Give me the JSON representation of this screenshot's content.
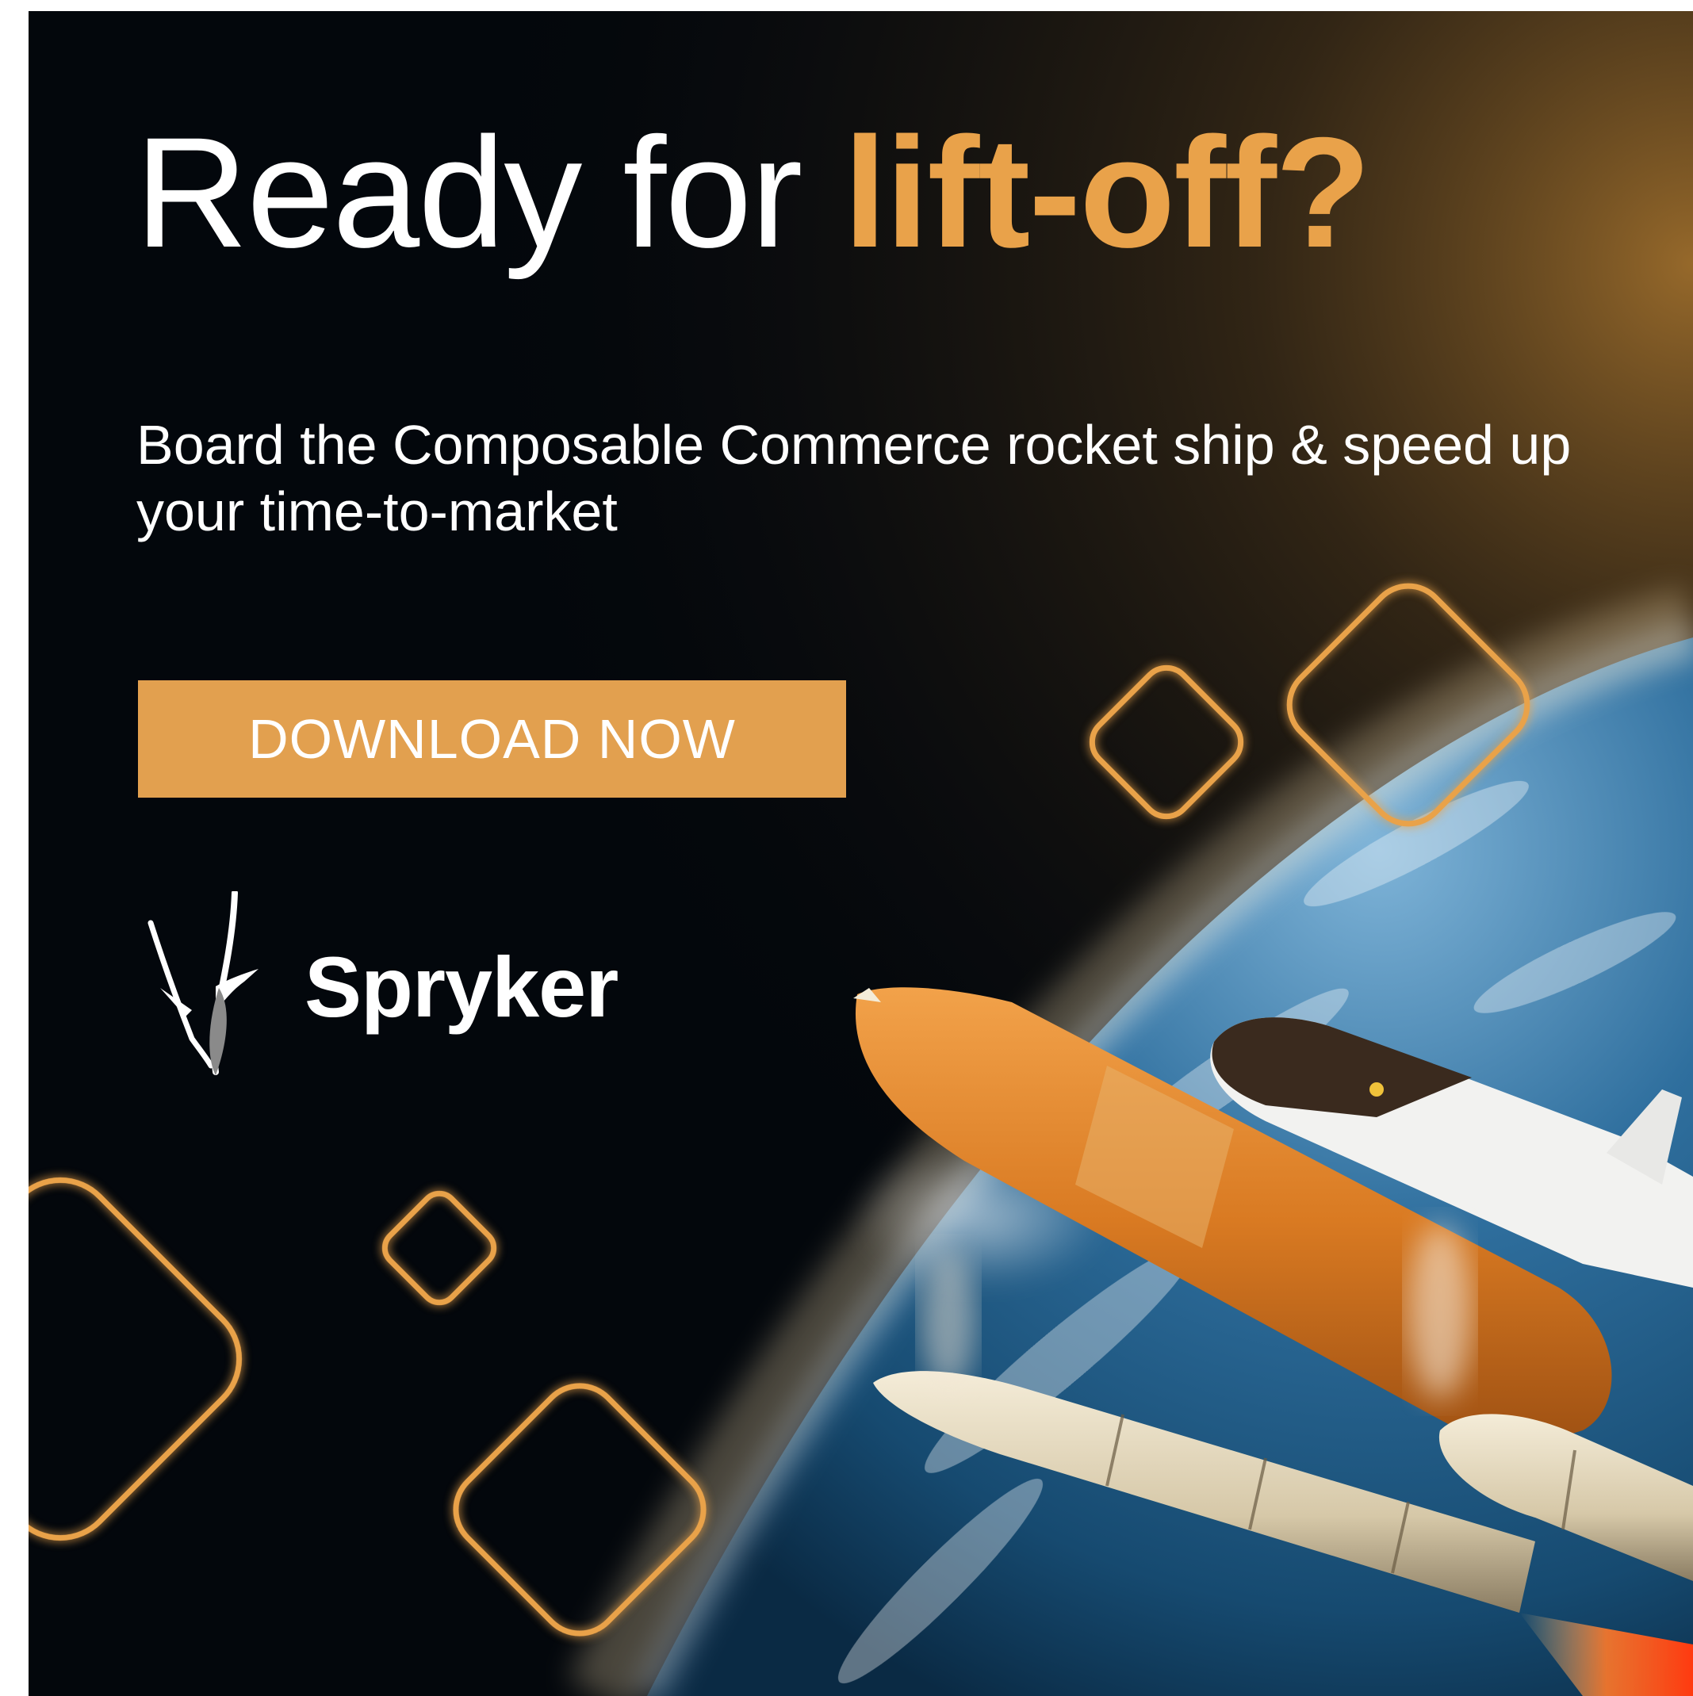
{
  "banner": {
    "headline_plain": "Ready for ",
    "headline_accent": "lift-off?",
    "subheadline": "Board the Composable Commerce rocket ship & speed up your time-to-market",
    "cta_label": "DOWNLOAD NOW",
    "brand_name": "Spryker"
  },
  "colors": {
    "accent": "#e9a24a",
    "button": "#e2a04f",
    "background": "#03070c",
    "text": "#ffffff"
  },
  "icons": [
    "spryker-logo-icon",
    "diamond-outline-icon",
    "space-shuttle-illustration",
    "earth-illustration"
  ]
}
